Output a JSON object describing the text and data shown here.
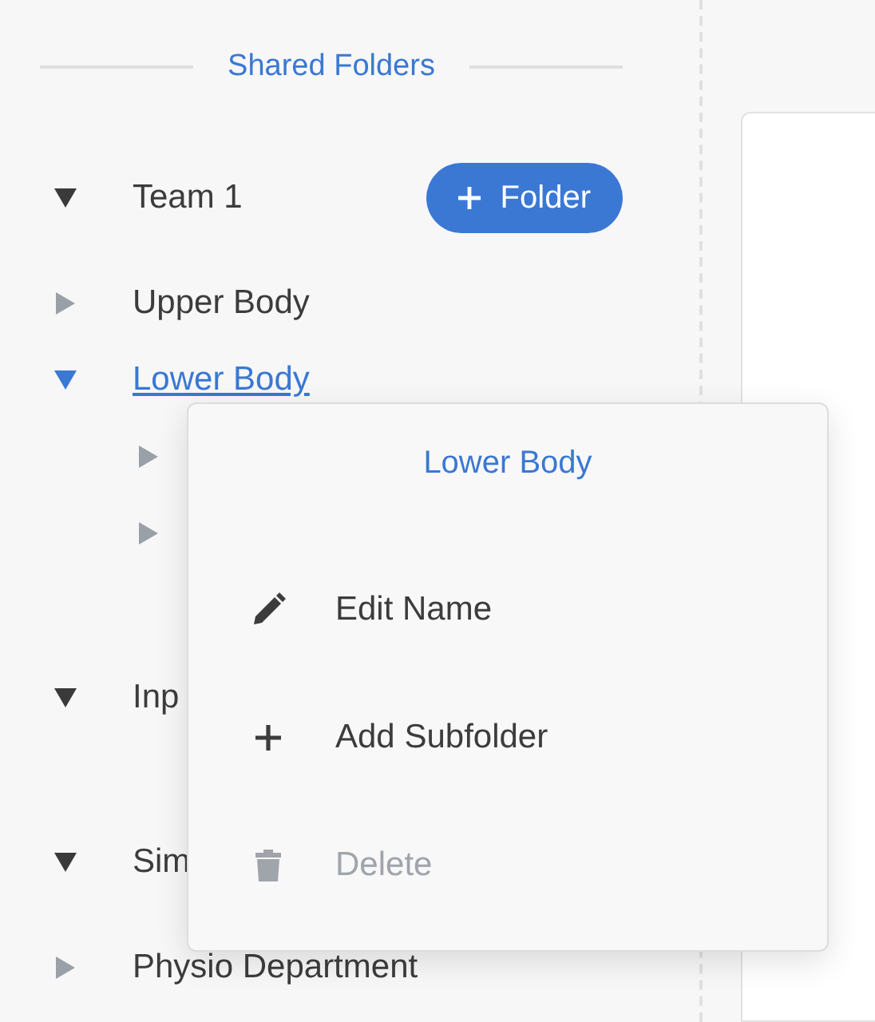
{
  "sidebar": {
    "title": "Shared Folders",
    "tree": [
      {
        "label": "Team 1",
        "expanded": true,
        "selected": false,
        "button": "Folder",
        "children": [
          {
            "label": "Upper Body",
            "expanded": false,
            "selected": false
          },
          {
            "label": "Lower Body",
            "expanded": true,
            "selected": true,
            "children": [
              {
                "expanded": false,
                "selected": false
              },
              {
                "expanded": false,
                "selected": false
              }
            ]
          }
        ]
      },
      {
        "label": "Inp",
        "expanded": true,
        "selected": false
      },
      {
        "label": "Sim",
        "expanded": true,
        "selected": false,
        "children": [
          {
            "label": "Physio Department",
            "expanded": false,
            "selected": false
          }
        ]
      }
    ]
  },
  "context_menu": {
    "title": "Lower Body",
    "items": [
      {
        "kind": "edit",
        "label": "Edit Name",
        "disabled": false
      },
      {
        "kind": "add",
        "label": "Add Subfolder",
        "disabled": false
      },
      {
        "kind": "delete",
        "label": "Delete",
        "disabled": true
      }
    ]
  }
}
